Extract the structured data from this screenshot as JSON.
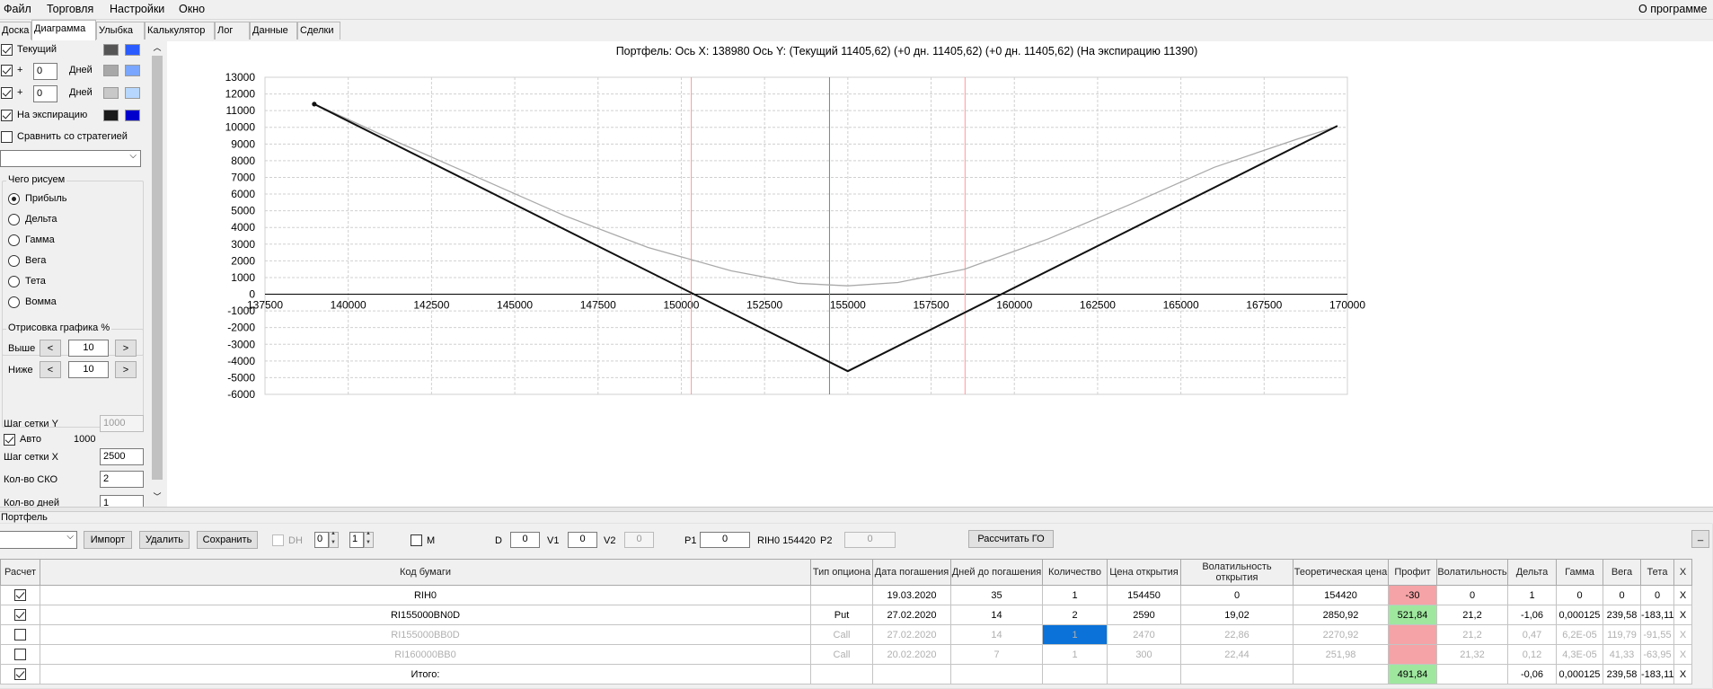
{
  "menu": {
    "file": "Файл",
    "trade": "Торговля",
    "settings": "Настройки",
    "window": "Окно",
    "about": "О программе"
  },
  "tabs": [
    "Доска",
    "Диаграмма",
    "Улыбка",
    "Калькулятор",
    "Лог",
    "Данные",
    "Сделки"
  ],
  "left": {
    "current": "Текущий",
    "plus": "+",
    "days": "Дней",
    "days1": "0",
    "days2": "0",
    "expiry": "На экспирацию",
    "compare": "Сравнить со стратегией",
    "what_title": "Чего рисуем",
    "what": [
      "Прибыль",
      "Дельта",
      "Гамма",
      "Вега",
      "Тета",
      "Вомма"
    ],
    "draw_title": "Отрисовка графика %",
    "above": "Выше",
    "below": "Ниже",
    "above_val": "10",
    "below_val": "10",
    "lt": "<",
    "gt": ">",
    "grid_y": "Шаг сетки Y",
    "grid_y_val": "1000",
    "auto": "Авто",
    "auto_val": "1000",
    "grid_x": "Шаг сетки X",
    "grid_x_val": "2500",
    "sko": "Кол-во СКО",
    "sko_val": "2",
    "days_cut": "Кол-во дней",
    "days_cut_val": "1"
  },
  "colors": {
    "current": [
      "#555555",
      "#2a5bff"
    ],
    "plus1": [
      "#a8a8a8",
      "#7aa6ff"
    ],
    "plus2": [
      "#c8c8c8",
      "#b7d7ff"
    ],
    "expiry": [
      "#1a1a1a",
      "#0000cc"
    ]
  },
  "chart_data": {
    "type": "line",
    "title": "Портфель: Ось X: 138980 Ось Y:  (Текущий 11405,62)  (+0 дн. 11405,62)  (+0 дн. 11405,62)  (На экспирацию 11390)",
    "xlim": [
      137500,
      170000
    ],
    "ylim": [
      -6000,
      13000
    ],
    "xticks": [
      "137500",
      "140000",
      "142500",
      "145000",
      "147500",
      "150000",
      "152500",
      "155000",
      "157500",
      "160000",
      "162500",
      "165000",
      "167500",
      "170000"
    ],
    "yticks": [
      "13000",
      "12000",
      "11000",
      "10000",
      "9000",
      "8000",
      "7000",
      "6000",
      "5000",
      "4000",
      "3000",
      "2000",
      "1000",
      "0",
      "-1000",
      "-2000",
      "-3000",
      "-4000",
      "-5000",
      "-6000"
    ],
    "series": [
      {
        "color": "#111111",
        "x": [
          138980,
          155000,
          169700
        ],
        "y": [
          11390,
          -4610,
          10090
        ]
      },
      {
        "color": "#aaaaaa",
        "x": [
          138980,
          141500,
          144000,
          146500,
          149000,
          151500,
          153500,
          155000,
          156500,
          158500,
          161000,
          163500,
          166000,
          168500,
          169700
        ],
        "y": [
          11405,
          9100,
          6900,
          4700,
          2800,
          1400,
          650,
          500,
          700,
          1500,
          3300,
          5400,
          7600,
          9300,
          10050
        ]
      }
    ],
    "vlines": [
      {
        "x": 150300,
        "color": "#ff9a9a"
      },
      {
        "x": 154450,
        "color": "#7a8290"
      },
      {
        "x": 158520,
        "color": "#ff9a9a"
      }
    ]
  },
  "port": {
    "label": "Портфель",
    "import": "Импорт",
    "delete": "Удалить",
    "save": "Сохранить",
    "dh": "DH",
    "dh1": "0",
    "dh2": "1",
    "m": "M",
    "d": "D",
    "d_val": "0",
    "v1": "V1",
    "v1_val": "0",
    "v2": "V2",
    "v2_val": "0",
    "p1": "P1",
    "p1_val": "0",
    "ri": "RIH0 154420",
    "p2": "P2",
    "p2_val": "0",
    "calc": "Рассчитать ГО",
    "min": "_"
  },
  "headers": [
    "Расчет",
    "Код бумаги",
    "Тип опциона",
    "Дата погашения",
    "Дней до погашения",
    "Количество",
    "Цена открытия",
    "Волатильность открытия",
    "Теоретическая цена",
    "Профит",
    "Волатильность",
    "Дельта",
    "Гамма",
    "Вега",
    "Тета",
    "X"
  ],
  "rows": [
    {
      "chk": true,
      "dim": false,
      "cells": [
        "RIH0",
        "",
        "19.03.2020",
        "35",
        "1",
        "154450",
        "0",
        "154420",
        "-30",
        "0",
        "1",
        "0",
        "0",
        "0",
        "X"
      ],
      "profit": "neg"
    },
    {
      "chk": true,
      "dim": false,
      "cells": [
        "RI155000BN0D",
        "Put",
        "27.02.2020",
        "14",
        "2",
        "2590",
        "19,02",
        "2850,92",
        "521,84",
        "21,2",
        "-1,06",
        "0,000125",
        "239,58",
        "-183,11",
        "X"
      ],
      "profit": "pos"
    },
    {
      "chk": false,
      "dim": true,
      "cells": [
        "RI155000BB0D",
        "Call",
        "27.02.2020",
        "14",
        "1",
        "2470",
        "22,86",
        "2270,92",
        "",
        "21,2",
        "0,47",
        "6,2E-05",
        "119,79",
        "-91,55",
        "X"
      ],
      "profit": "neg",
      "sel": 4
    },
    {
      "chk": false,
      "dim": true,
      "cells": [
        "RI160000BB0",
        "Call",
        "20.02.2020",
        "7",
        "1",
        "300",
        "22,44",
        "251,98",
        "",
        "21,32",
        "0,12",
        "4,3E-05",
        "41,33",
        "-63,95",
        "X"
      ],
      "profit": "neg"
    },
    {
      "chk": true,
      "dim": false,
      "cells": [
        "Итого:",
        "",
        "",
        "",
        "",
        "",
        "",
        "",
        "491,84",
        "",
        "-0,06",
        "0,000125",
        "239,58",
        "-183,11",
        "X"
      ],
      "profit": "pos"
    }
  ]
}
